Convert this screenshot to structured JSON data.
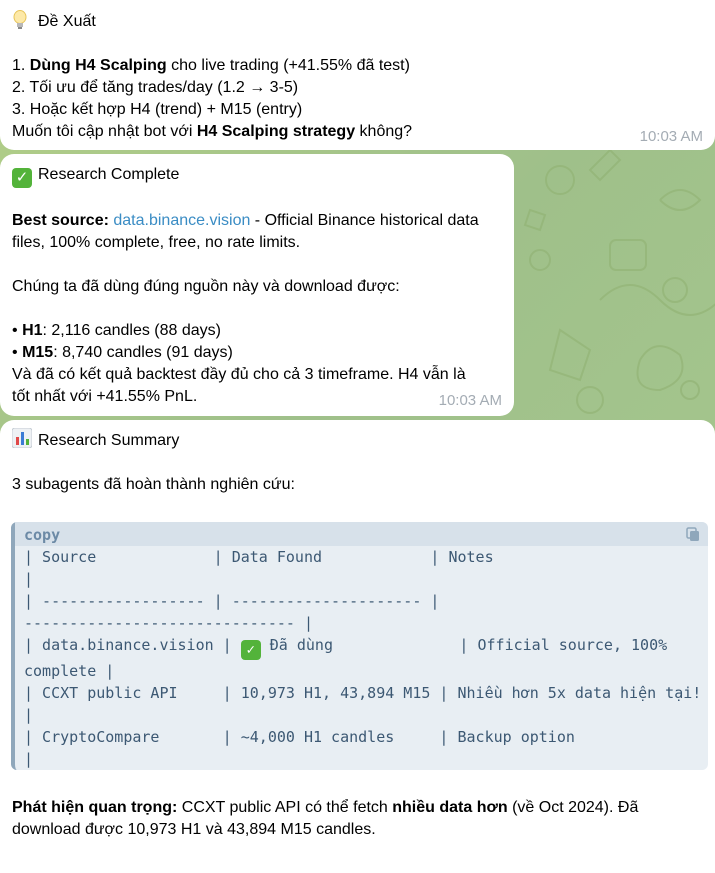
{
  "msg1": {
    "title": "Đề Xuất",
    "items": [
      {
        "pre": "1. ",
        "bold": "Dùng H4 Scalping",
        "post": " cho live trading (+41.55% đã test)"
      },
      {
        "text": "2. Tối ưu để tăng trades/day (1.2 → 3-5)"
      },
      {
        "text": "3. Hoặc kết hợp H4 (trend) + M15 (entry)"
      }
    ],
    "question_pre": "Muốn tôi cập nhật bot với ",
    "question_bold": "H4 Scalping strategy",
    "question_post": " không?",
    "time": "10:03 AM"
  },
  "msg2": {
    "title": "Research Complete",
    "best_label": "Best source:",
    "best_link": "data.binance.vision",
    "best_line1_rest": " - Official Binance historical data",
    "best_line2": "files, 100% complete, free, no rate limits.",
    "used_line": "Chúng ta đã dùng đúng nguồn này và download được:",
    "h1_label": "H1",
    "h1_text": ": 2,116 candles (88 days)",
    "m15_label": "M15",
    "m15_text": ": 8,740 candles (91 days)",
    "result_line1": "Và đã có kết quả backtest đầy đủ cho cả 3 timeframe. H4 vẫn là",
    "result_line2": "tốt nhất với +41.55% PnL.",
    "bullet": "•",
    "time": "10:03 AM"
  },
  "msg3": {
    "title": "Research Summary",
    "intro": "3 subagents đã hoàn thành nghiên cứu:",
    "code_lang": "copy",
    "code_lines": [
      "| Source             | Data Found            | Notes",
      "|",
      "| ------------------ | --------------------- |",
      "------------------------------ |"
    ],
    "row1_a": "| data.binance.vision | ",
    "row1_check": "✓",
    "row1_b": " Đã dùng              | Official source, 100%",
    "row1_c": "complete |",
    "code_lines_after": [
      "| CCXT public API     | 10,973 H1, 43,894 M15 | Nhiều hơn 5x data hiện tại!",
      "|",
      "| CryptoCompare       | ~4,000 H1 candles     | Backup option",
      "|"
    ],
    "finding_label": "Phát hiện quan trọng:",
    "finding_pre": " CCXT public API có thể fetch ",
    "finding_bold": "nhiều data hơn",
    "finding_post": " (về Oct 2024). Đã",
    "finding_line2": "download được 10,973 H1 và 43,894 M15 candles."
  },
  "icons": {
    "bulb": "lightbulb-icon",
    "check": "check-mark-icon",
    "chart": "bar-chart-icon",
    "copy": "copy-icon"
  },
  "colors": {
    "link": "#3a8cc4",
    "time": "#a4acb4",
    "code_text": "#3c5873",
    "check_green": "#53b33a",
    "wallpaper": "#a8c88a"
  }
}
